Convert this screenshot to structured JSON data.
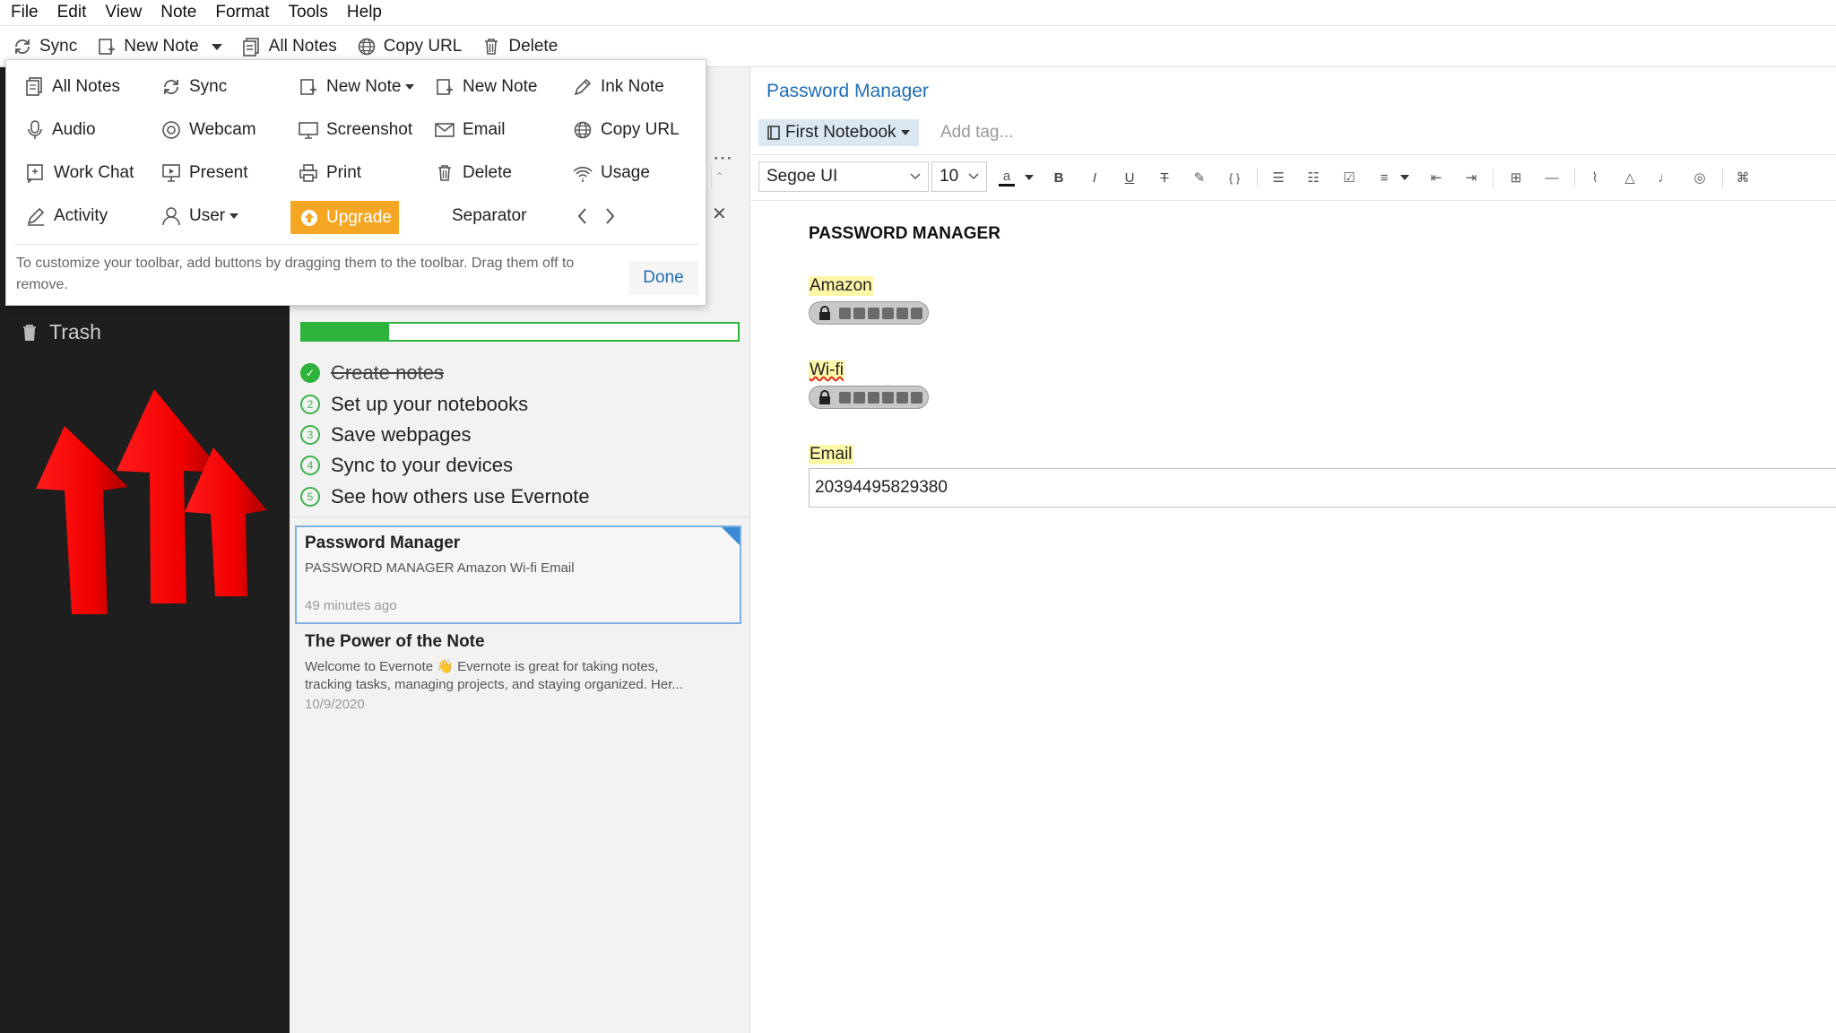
{
  "menubar": [
    "File",
    "Edit",
    "View",
    "Note",
    "Format",
    "Tools",
    "Help"
  ],
  "toolbar": {
    "sync": "Sync",
    "new_note": "New Note",
    "all_notes": "All Notes",
    "copy_url": "Copy URL",
    "delete": "Delete"
  },
  "customize": {
    "items": {
      "all_notes": "All Notes",
      "sync": "Sync",
      "new_note_menu": "New Note",
      "new_note": "New Note",
      "ink_note": "Ink Note",
      "audio": "Audio",
      "webcam": "Webcam",
      "screenshot": "Screenshot",
      "email": "Email",
      "copy_url": "Copy URL",
      "work_chat": "Work Chat",
      "present": "Present",
      "print": "Print",
      "delete": "Delete",
      "usage": "Usage",
      "activity": "Activity",
      "user": "User",
      "upgrade": "Upgrade",
      "separator": "Separator"
    },
    "hint": "To customize your toolbar, add buttons by dragging them to the toolbar. Drag them off to remove.",
    "done": "Done",
    "accent": "#f5a623"
  },
  "sidebar": {
    "trash": "Trash",
    "arrow_color": "#ff0000"
  },
  "getting_started": {
    "progress": 0.2,
    "progress_color": "#2db33b",
    "tasks": [
      {
        "num": "",
        "text": "Create notes",
        "done": true
      },
      {
        "num": "2",
        "text": "Set up your notebooks",
        "done": false
      },
      {
        "num": "3",
        "text": "Save webpages",
        "done": false
      },
      {
        "num": "4",
        "text": "Sync to your devices",
        "done": false
      },
      {
        "num": "5",
        "text": "See how others use Evernote",
        "done": false
      }
    ]
  },
  "notes": [
    {
      "title": "Password Manager",
      "snippet": "PASSWORD MANAGER Amazon Wi-fi Email",
      "time": "49 minutes ago"
    },
    {
      "title": "The Power of the Note",
      "snippet1": "Welcome to Evernote 👋 Evernote is great for taking notes,",
      "snippet2": "tracking tasks, managing projects, and staying organized. Her...",
      "time": "10/9/2020"
    }
  ],
  "editor": {
    "title": "Password Manager",
    "notebook": "First Notebook",
    "add_tag": "Add tag...",
    "font": "Segoe UI",
    "size": "10",
    "heading": "PASSWORD MANAGER",
    "fields": [
      {
        "label": "Amazon"
      },
      {
        "label": "Wi-fi"
      },
      {
        "label": "Email",
        "value": "20394495829380"
      }
    ],
    "title_color": "#1f6fb5",
    "highlight_color": "#fff7a8"
  }
}
